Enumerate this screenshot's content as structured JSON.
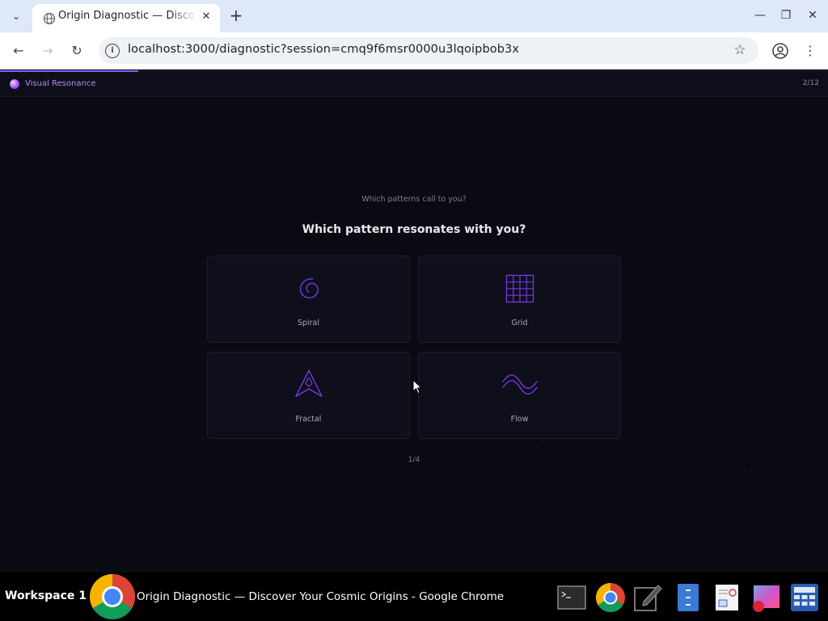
{
  "browser": {
    "tab_title": "Origin Diagnostic — Discover Your Cosmic Origins",
    "tab_close": "✕",
    "new_tab": "+",
    "url": "localhost:3000/diagnostic?session=cmq9f6msr0000u3lqoipbob3x",
    "info_glyph": "i",
    "star_glyph": "☆",
    "back_glyph": "←",
    "forward_glyph": "→",
    "reload_glyph": "↻",
    "menu_glyph": "⋮",
    "minimize_glyph": "—",
    "restore_glyph": "❐",
    "close_glyph": "✕",
    "tabsearch_glyph": "⌄"
  },
  "app": {
    "brand": "Visual Resonance",
    "step": "2/12",
    "progress_fraction": 0.167,
    "subtitle": "Which patterns call to you?",
    "question": "Which pattern resonates with you?",
    "options": [
      {
        "label": "Spiral",
        "icon": "spiral-icon"
      },
      {
        "label": "Grid",
        "icon": "grid-icon"
      },
      {
        "label": "Fractal",
        "icon": "fractal-icon"
      },
      {
        "label": "Flow",
        "icon": "flow-icon"
      }
    ],
    "pager": "1/4",
    "accent": "#8b5cf6",
    "brand_color": "#b48cf5",
    "background": "#0a0a13"
  },
  "taskbar": {
    "workspace": "Workspace 1",
    "window_title": "Origin Diagnostic — Discover Your Cosmic Origins - Google Chrome",
    "tray_icons": [
      "terminal-icon",
      "chrome-icon",
      "text-editor-icon",
      "file-manager-icon",
      "document-viewer-icon",
      "image-viewer-icon",
      "calculator-icon"
    ]
  }
}
